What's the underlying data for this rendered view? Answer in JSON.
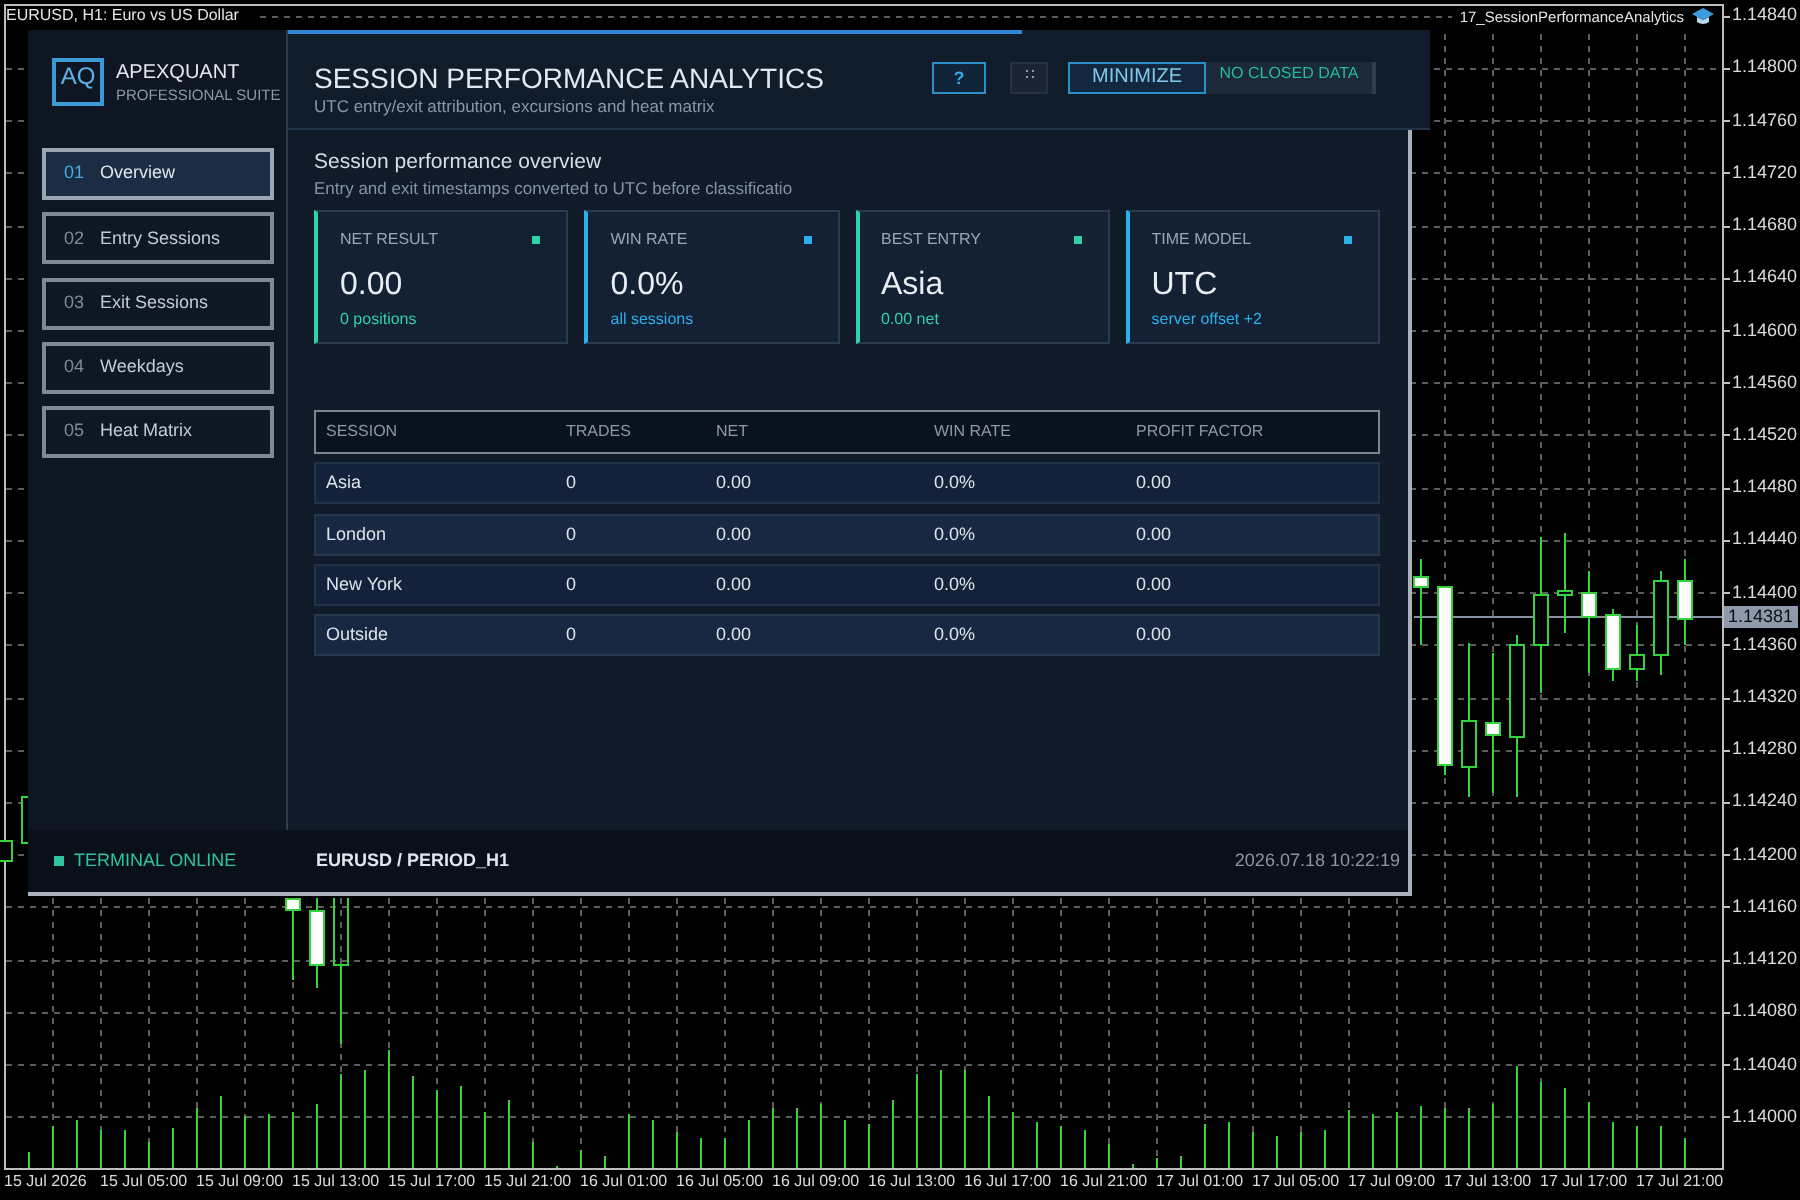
{
  "chart": {
    "indicator": "17_SessionPerformanceAnalytics",
    "current_price": "1.14381",
    "chart_data": {
      "type": "candlestick",
      "title": "EURUSD, H1: Euro vs US Dollar",
      "grid": true,
      "categories": [
        null,
        null,
        "15 Jul 2026",
        null,
        null,
        null,
        "15 Jul 05:00",
        null,
        null,
        null,
        "15 Jul 09:00",
        null,
        null,
        null,
        "15 Jul 13:00",
        null,
        null,
        null,
        "15 Jul 17:00",
        null,
        null,
        null,
        "15 Jul 21:00",
        null,
        null,
        null,
        "16 Jul 01:00",
        null,
        null,
        null,
        "16 Jul 05:00",
        null,
        null,
        null,
        "16 Jul 09:00",
        null,
        null,
        null,
        "16 Jul 13:00",
        null,
        null,
        null,
        "16 Jul 17:00",
        null,
        null,
        null,
        "16 Jul 21:00",
        null,
        null,
        null,
        "17 Jul 01:00",
        null,
        null,
        null,
        "17 Jul 05:00",
        null,
        null,
        null,
        "17 Jul 09:00",
        null,
        null,
        null,
        "17 Jul 13:00",
        null,
        null,
        null,
        "17 Jul 17:00",
        null,
        null,
        null,
        "17 Jul 21:00"
      ],
      "ohlc": [
        [
          1.14195,
          1.14211,
          1.14195,
          1.14211
        ],
        [
          1.14209,
          1.14244,
          1.14209,
          1.14244
        ],
        null,
        null,
        null,
        null,
        null,
        null,
        null,
        null,
        null,
        null,
        null,
        null,
        null,
        null,
        null,
        null,
        null,
        null,
        null,
        null,
        null,
        null,
        null,
        null,
        null,
        null,
        null,
        null,
        null,
        null,
        null,
        null,
        null,
        null,
        null,
        null,
        null,
        null,
        null,
        null,
        null,
        null,
        null,
        null,
        null,
        null,
        null,
        null,
        null,
        null,
        null,
        null,
        null,
        null,
        null,
        null,
        null,
        [
          1.14412,
          1.14426,
          1.1436,
          1.14405
        ],
        [
          1.14405,
          1.14405,
          1.14261,
          1.14269
        ],
        [
          1.14267,
          1.14362,
          1.14244,
          1.14302
        ],
        [
          1.14301,
          1.14354,
          1.14247,
          1.14292
        ],
        [
          1.1429,
          1.14368,
          1.14244,
          1.1436
        ],
        [
          1.1436,
          1.14443,
          1.14324,
          1.14399
        ],
        [
          1.14399,
          1.14446,
          1.1437,
          1.14402
        ],
        [
          1.144,
          1.14417,
          1.14339,
          1.14382
        ],
        [
          1.14383,
          1.14388,
          1.14333,
          1.14342
        ],
        [
          1.14342,
          1.14376,
          1.14333,
          1.14353
        ],
        [
          1.14353,
          1.14417,
          1.14338,
          1.14409
        ],
        [
          1.14409,
          1.14426,
          1.1436,
          1.14381
        ]
      ],
      "ylim": [
        1.1396,
        1.14848
      ],
      "yticks": [
        {
          "value": 1.1484,
          "label": "1.14840"
        },
        {
          "value": 1.148,
          "label": "1.14800"
        },
        {
          "value": 1.1476,
          "label": "1.14760"
        },
        {
          "value": 1.1472,
          "label": "1.14720"
        },
        {
          "value": 1.1468,
          "label": "1.14680"
        },
        {
          "value": 1.1464,
          "label": "1.14640"
        },
        {
          "value": 1.146,
          "label": "1.14600"
        },
        {
          "value": 1.1456,
          "label": "1.14560"
        },
        {
          "value": 1.1452,
          "label": "1.14520"
        },
        {
          "value": 1.1448,
          "label": "1.14480"
        },
        {
          "value": 1.1444,
          "label": "1.14440"
        },
        {
          "value": 1.144,
          "label": "1.14400"
        },
        {
          "value": 1.1436,
          "label": "1.14360"
        },
        {
          "value": 1.1432,
          "label": "1.14320"
        },
        {
          "value": 1.1428,
          "label": "1.14280"
        },
        {
          "value": 1.1424,
          "label": "1.14240"
        },
        {
          "value": 1.142,
          "label": "1.14200"
        },
        {
          "value": 1.1416,
          "label": "1.14160"
        },
        {
          "value": 1.1412,
          "label": "1.14120"
        },
        {
          "value": 1.1408,
          "label": "1.14080"
        },
        {
          "value": 1.1404,
          "label": "1.14040"
        },
        {
          "value": 1.14,
          "label": "1.14000"
        }
      ]
    }
  },
  "sidebar": {
    "logo": "AQ",
    "brand": "APEXQUANT",
    "tagline": "PROFESSIONAL SUITE",
    "nav": [
      {
        "number": "01",
        "label": "Overview",
        "selected": true
      },
      {
        "number": "02",
        "label": "Entry Sessions",
        "selected": false
      },
      {
        "number": "03",
        "label": "Exit Sessions",
        "selected": false
      },
      {
        "number": "04",
        "label": "Weekdays",
        "selected": false
      },
      {
        "number": "05",
        "label": "Heat Matrix",
        "selected": false
      }
    ]
  },
  "header": {
    "title": "SESSION PERFORMANCE ANALYTICS",
    "subtitle": "UTC entry/exit attribution, excursions and heat matrix",
    "help_button": "?",
    "minimize_button": "MINIMIZE",
    "status_badge": "NO CLOSED DATA"
  },
  "overview": {
    "title": "Session performance overview",
    "subtitle": "Entry and exit timestamps converted to UTC before classificatio",
    "cards": [
      {
        "label": "NET RESULT",
        "value": "0.00",
        "note": "0 positions",
        "color": "#2fd1a6"
      },
      {
        "label": "WIN RATE",
        "value": "0.0%",
        "note": "all sessions",
        "color": "#2bb0ec"
      },
      {
        "label": "BEST ENTRY",
        "value": "Asia",
        "note": "0.00 net",
        "color": "#2fd1a6"
      },
      {
        "label": "TIME MODEL",
        "value": "UTC",
        "note": "server offset +2",
        "color": "#2bb0ec"
      }
    ]
  },
  "table": {
    "columns": [
      "SESSION",
      "TRADES",
      "NET",
      "WIN RATE",
      "PROFIT FACTOR"
    ],
    "rows": [
      [
        "Asia",
        "0",
        "0.00",
        "0.0%",
        "0.00"
      ],
      [
        "London",
        "0",
        "0.00",
        "0.0%",
        "0.00"
      ],
      [
        "New York",
        "0",
        "0.00",
        "0.0%",
        "0.00"
      ],
      [
        "Outside",
        "0",
        "0.00",
        "0.0%",
        "0.00"
      ]
    ]
  },
  "status_bar": {
    "online": true,
    "status": "TERMINAL ONLINE",
    "symbol": "EURUSD / PERIOD_H1",
    "timestamp": "2026.07.18 10:22:19"
  }
}
